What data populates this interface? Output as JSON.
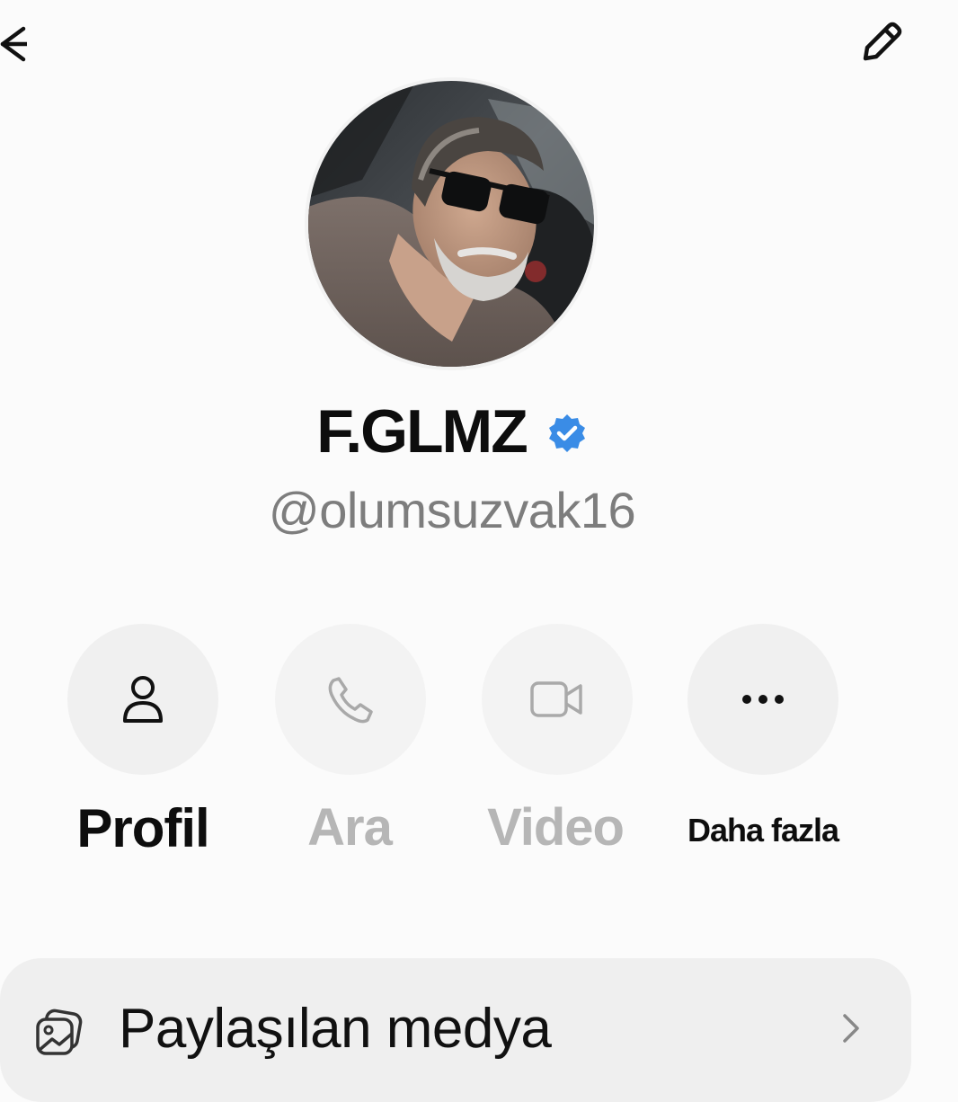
{
  "topbar": {
    "back_icon": "back-arrow-icon",
    "edit_icon": "pencil-icon"
  },
  "profile": {
    "name": "F.GLMZ",
    "verified": true,
    "verified_color": "#3a8ce6",
    "handle": "@olumsuzvak16"
  },
  "actions": [
    {
      "label": "Profil",
      "icon": "person-icon",
      "enabled": true
    },
    {
      "label": "Ara",
      "icon": "phone-icon",
      "enabled": false
    },
    {
      "label": "Video",
      "icon": "video-camera-icon",
      "enabled": false
    },
    {
      "label": "Daha fazla",
      "icon": "more-dots-icon",
      "enabled": true
    }
  ],
  "menu": {
    "items": [
      {
        "label": "Paylaşılan medya",
        "icon": "shared-media-icon",
        "chevron": "chevron-right-icon"
      }
    ]
  },
  "colors": {
    "background": "#fbfbfb",
    "circle": "#f0f0f0",
    "disabled_text": "#b6b6b6",
    "handle_text": "#7d7d7d",
    "card": "#efefef"
  }
}
